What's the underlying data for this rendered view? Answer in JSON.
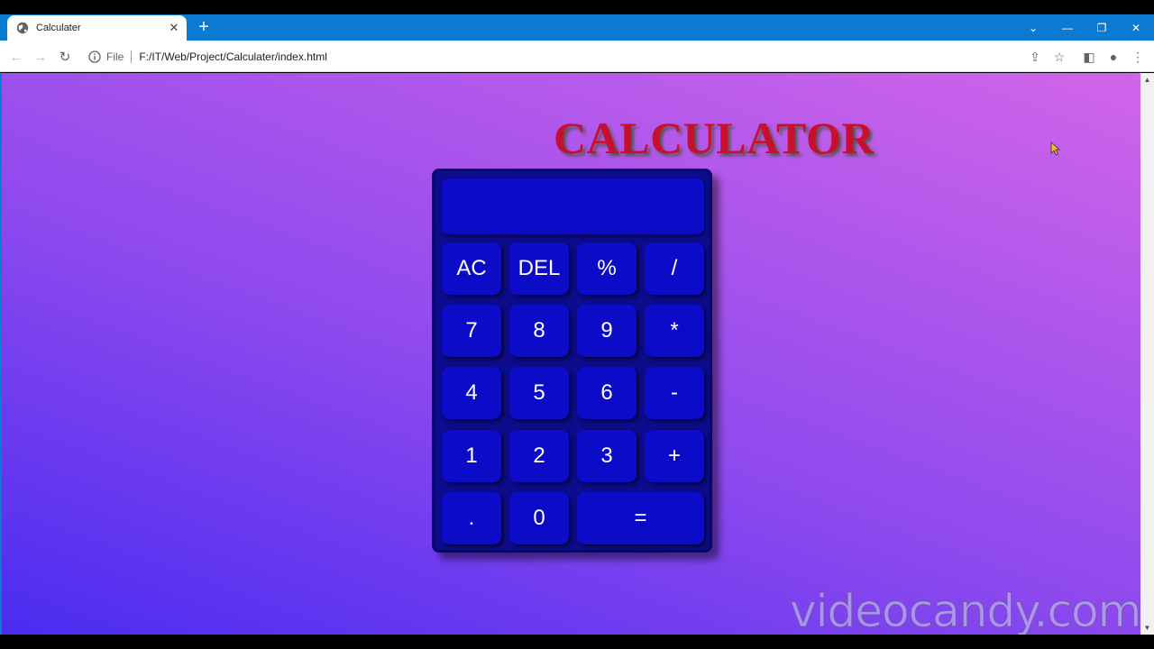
{
  "browser": {
    "tab_title": "Calculater",
    "tab_close": "✕",
    "new_tab": "+",
    "window_controls": {
      "dropdown": "⌄",
      "minimize": "—",
      "restore": "❐",
      "close": "✕"
    },
    "nav": {
      "back": "←",
      "forward": "→",
      "reload": "↻"
    },
    "omnibox": {
      "scheme_label": "File",
      "url": "F:/IT/Web/Project/Calculater/index.html"
    },
    "right_buttons": {
      "share": "⇪",
      "bookmark": "☆",
      "sidebar": "◧",
      "profile": "●",
      "menu": "⋮"
    }
  },
  "page": {
    "heading": "CALCULATOR",
    "display_value": "",
    "keys": [
      [
        "AC",
        "DEL",
        "%",
        "/"
      ],
      [
        "7",
        "8",
        "9",
        "*"
      ],
      [
        "4",
        "5",
        "6",
        "-"
      ],
      [
        "1",
        "2",
        "3",
        "+"
      ],
      [
        ".",
        "0",
        "="
      ]
    ]
  },
  "watermark": "videocandy.com",
  "colors": {
    "tabstrip": "#0b7bd2",
    "heading": "#c8102e",
    "calc_body": "#0c0c8c",
    "key": "#0c0cc8",
    "gradient_start": "#4a2cf0",
    "gradient_end": "#d165e9"
  }
}
